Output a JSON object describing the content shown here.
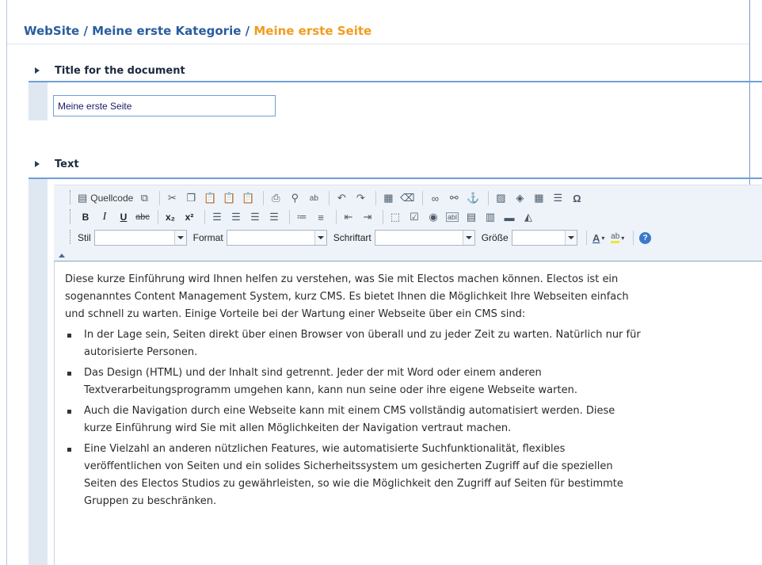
{
  "breadcrumb": {
    "root": "WebSite",
    "separator": "/",
    "category": "Meine erste Kategorie",
    "current": "Meine erste Seite"
  },
  "sections": {
    "title": {
      "label": "Title for the document",
      "input_value": "Meine erste Seite"
    },
    "text": {
      "label": "Text"
    }
  },
  "toolbar": {
    "source_label": "Quellcode",
    "style_label": "Stil",
    "format_label": "Format",
    "font_label": "Schriftart",
    "size_label": "Größe",
    "bold": "B",
    "italic": "I",
    "underline": "U",
    "strike": "abc",
    "subscript": "x₂",
    "superscript": "x²",
    "omega": "Ω"
  },
  "editor": {
    "intro": "Diese kurze Einführung wird Ihnen helfen zu verstehen, was Sie mit Electos machen können. Electos ist ein sogenanntes Content Management System, kurz CMS. Es bietet Ihnen die Möglichkeit Ihre Webseiten einfach und schnell zu warten. Einige Vorteile bei der Wartung einer Webseite über ein CMS sind:",
    "bullets": [
      "In der Lage sein, Seiten direkt über einen Browser von überall und zu jeder Zeit zu warten. Natürlich nur für autorisierte Personen.",
      "Das Design (HTML) und der Inhalt sind getrennt. Jeder der mit Word oder einem anderen Textverarbeitungsprogramm umgehen kann, kann nun seine oder ihre eigene Webseite warten.",
      "Auch die Navigation durch eine Webseite kann mit einem CMS vollständig automatisiert werden. Diese kurze Einführung wird Sie mit allen Möglichkeiten der Navigation vertraut machen.",
      "Eine Vielzahl an anderen nützlichen Features, wie automatisierte Suchfunktionalität, flexibles veröffentlichen von Seiten und ein solides Sicherheitssystem um gesicherten Zugriff auf die speziellen Seiten des Electos Studios zu gewährleisten, so wie die Möglichkeit den Zugriff auf Seiten für bestimmte Gruppen zu beschränken."
    ]
  },
  "colors": {
    "breadcrumb": "#2a5d9e",
    "breadcrumb_current": "#f29c1f",
    "section_underline": "#6f9fd8"
  }
}
